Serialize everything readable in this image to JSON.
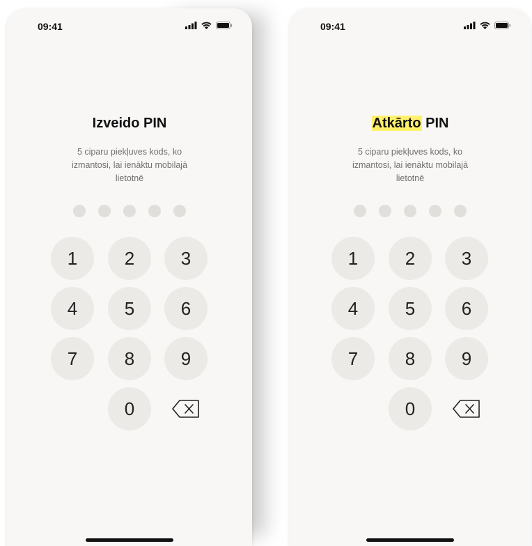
{
  "screens": [
    {
      "status_time": "09:41",
      "title_highlight": "",
      "title_text": "Izveido PIN",
      "subtitle": "5 ciparu piekļuves kods, ko izmantosi, lai ienāktu mobilajā lietotnē",
      "pin_length": 5,
      "pin_filled": 0,
      "keys": [
        "1",
        "2",
        "3",
        "4",
        "5",
        "6",
        "7",
        "8",
        "9",
        "0"
      ],
      "backspace_icon": "backspace-icon"
    },
    {
      "status_time": "09:41",
      "title_highlight": "Atkārto",
      "title_text": " PIN",
      "subtitle": "5 ciparu piekļuves kods, ko izmantosi, lai ienāktu mobilajā lietotnē",
      "pin_length": 5,
      "pin_filled": 0,
      "keys": [
        "1",
        "2",
        "3",
        "4",
        "5",
        "6",
        "7",
        "8",
        "9",
        "0"
      ],
      "backspace_icon": "backspace-icon"
    }
  ],
  "colors": {
    "background": "#f8f7f5",
    "key_fill": "#ebeae6",
    "dot_empty": "#e0dfdc",
    "highlight": "#fff06a",
    "text_primary": "#111111",
    "text_secondary": "#6f6f6f"
  }
}
